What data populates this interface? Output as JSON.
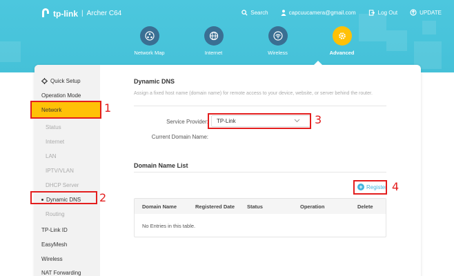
{
  "header": {
    "brand": "tp-link",
    "model": "Archer C64",
    "actions": [
      {
        "label": "Search",
        "icon": "search-icon"
      },
      {
        "label": "capcuucamera@gmail.com",
        "icon": "user-icon"
      },
      {
        "label": "Log Out",
        "icon": "logout-icon"
      },
      {
        "label": "UPDATE",
        "icon": "update-icon"
      }
    ],
    "tabs": [
      {
        "label": "Network Map",
        "icon": "network-map-icon",
        "active": false
      },
      {
        "label": "Internet",
        "icon": "globe-icon",
        "active": false
      },
      {
        "label": "Wireless",
        "icon": "wifi-icon",
        "active": false
      },
      {
        "label": "Advanced",
        "icon": "gear-icon",
        "active": true
      }
    ]
  },
  "sidebar": {
    "items": [
      {
        "label": "Quick Setup",
        "icon": "quick-setup-icon"
      },
      {
        "label": "Operation Mode"
      },
      {
        "label": "Network",
        "selected": true
      },
      {
        "label": "Status",
        "sub": true
      },
      {
        "label": "Internet",
        "sub": true
      },
      {
        "label": "LAN",
        "sub": true
      },
      {
        "label": "IPTV/VLAN",
        "sub": true
      },
      {
        "label": "DHCP Server",
        "sub": true
      },
      {
        "label": "Dynamic DNS",
        "sub": true,
        "active": true
      },
      {
        "label": "Routing",
        "sub": true
      },
      {
        "label": "TP-Link ID"
      },
      {
        "label": "EasyMesh"
      },
      {
        "label": "Wireless"
      },
      {
        "label": "NAT Forwarding"
      }
    ]
  },
  "main": {
    "title": "Dynamic DNS",
    "description": "Assign a fixed host name (domain name) for remote access to your device, website, or server behind the router.",
    "service_provider_label": "Service Provider:",
    "service_provider_value": "TP-Link",
    "current_domain_label": "Current Domain Name:",
    "domain_list_title": "Domain Name List",
    "register_label": "Register",
    "table": {
      "columns": [
        "Domain Name",
        "Registered Date",
        "Status",
        "Operation",
        "Delete"
      ],
      "empty_text": "No Entries in this table."
    }
  },
  "annotations": [
    "1",
    "2",
    "3",
    "4"
  ],
  "colors": {
    "header_bg": "#4cc7de",
    "accent_yellow": "#ffc107",
    "annotation_red": "#e31d1d",
    "link_blue": "#42b4dd"
  }
}
